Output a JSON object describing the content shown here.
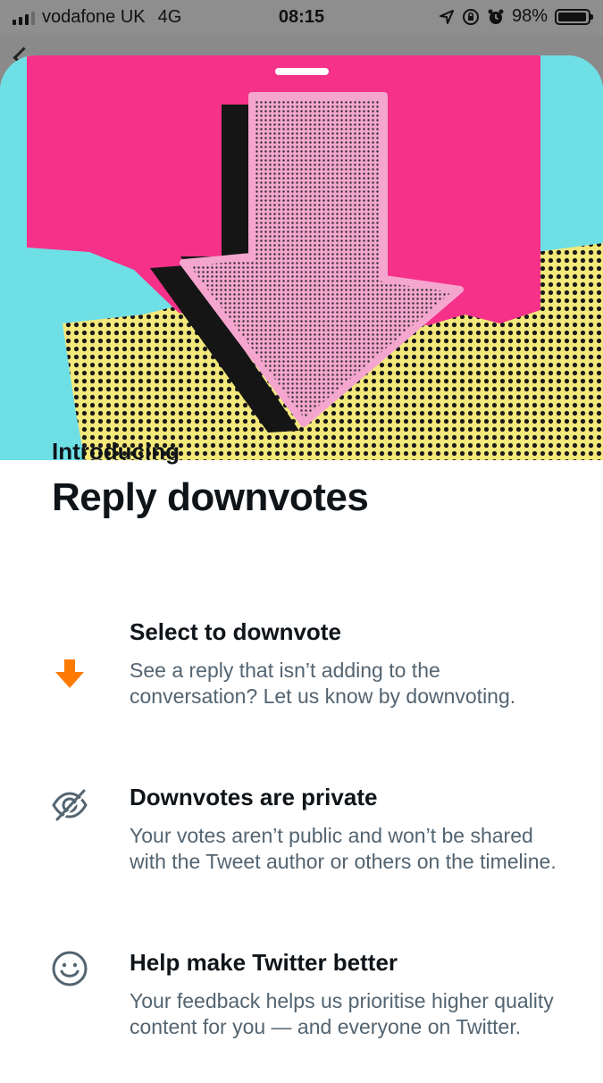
{
  "status_bar": {
    "carrier": "vodafone UK",
    "network": "4G",
    "time": "08:15",
    "battery": "98%",
    "battery_level": 0.98,
    "icons": [
      "signal-icon",
      "location-icon",
      "rotation-lock-icon",
      "alarm-icon",
      "battery-icon"
    ]
  },
  "sheet": {
    "intro": "Introducing",
    "title": "Reply downvotes",
    "features": [
      {
        "icon": "arrow-down-icon",
        "title": "Select to downvote",
        "description": "See a reply that isn’t adding to the conversation? Let us know by downvoting."
      },
      {
        "icon": "eye-slash-icon",
        "title": "Downvotes are private",
        "description": "Your votes aren’t public and won’t be shared with the Tweet author or others on the timeline."
      },
      {
        "icon": "smiley-icon",
        "title": "Help make Twitter better",
        "description": "Your feedback helps us prioritise higher quality content for you — and everyone on Twitter."
      }
    ]
  },
  "colors": {
    "hero_cyan": "#6fdfe6",
    "hero_pink": "#f5318a",
    "hero_yellow": "#f3e87a",
    "arrow_pink": "#f4a6cf",
    "accent_orange": "#ff7a00",
    "text_primary": "#0f1419",
    "text_secondary": "#536471"
  }
}
